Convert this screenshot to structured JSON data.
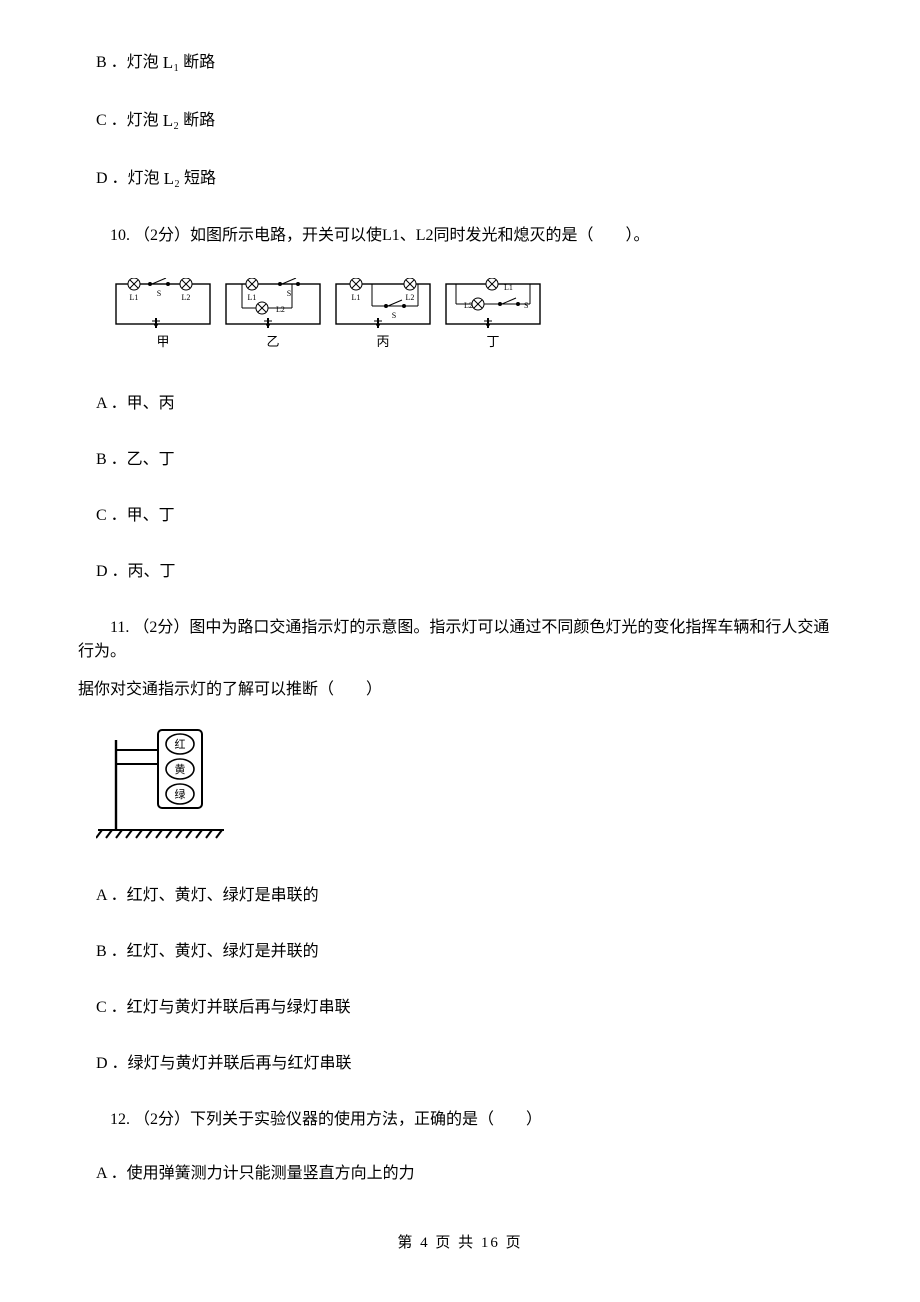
{
  "q9": {
    "b_prefix": "B ．灯泡 ",
    "b_label": "L",
    "b_sub": "1",
    "b_suffix": " 断路",
    "c_prefix": "C ．灯泡 ",
    "c_label": "L",
    "c_sub": "2",
    "c_suffix": " 断路",
    "d_prefix": "D ．灯泡 ",
    "d_label": "L",
    "d_sub": "2",
    "d_suffix": " 短路"
  },
  "q10": {
    "stem": "10. （2分）如图所示电路，开关可以使L1、L2同时发光和熄灭的是（　　）。",
    "diagram_labels": {
      "a": "甲",
      "b": "乙",
      "c": "丙",
      "d": "丁"
    },
    "opts": {
      "a": "A ．甲、丙",
      "b": "B ．乙、丁",
      "c": "C ．甲、丁",
      "d": "D ．丙、丁"
    }
  },
  "q11": {
    "stem_line1": "11. （2分）图中为路口交通指示灯的示意图。指示灯可以通过不同颜色灯光的变化指挥车辆和行人交通行为。",
    "stem_line2": "据你对交通指示灯的了解可以推断（　　）",
    "lights": {
      "red": "红",
      "yellow": "黄",
      "green": "绿"
    },
    "opts": {
      "a": "A ．红灯、黄灯、绿灯是串联的",
      "b": "B ．红灯、黄灯、绿灯是并联的",
      "c": "C ．红灯与黄灯并联后再与绿灯串联",
      "d": "D ．绿灯与黄灯并联后再与红灯串联"
    }
  },
  "q12": {
    "stem": "12. （2分）下列关于实验仪器的使用方法，正确的是（　　）",
    "opts": {
      "a": "A ．使用弹簧测力计只能测量竖直方向上的力"
    }
  },
  "footer": "第 4 页 共 16 页"
}
